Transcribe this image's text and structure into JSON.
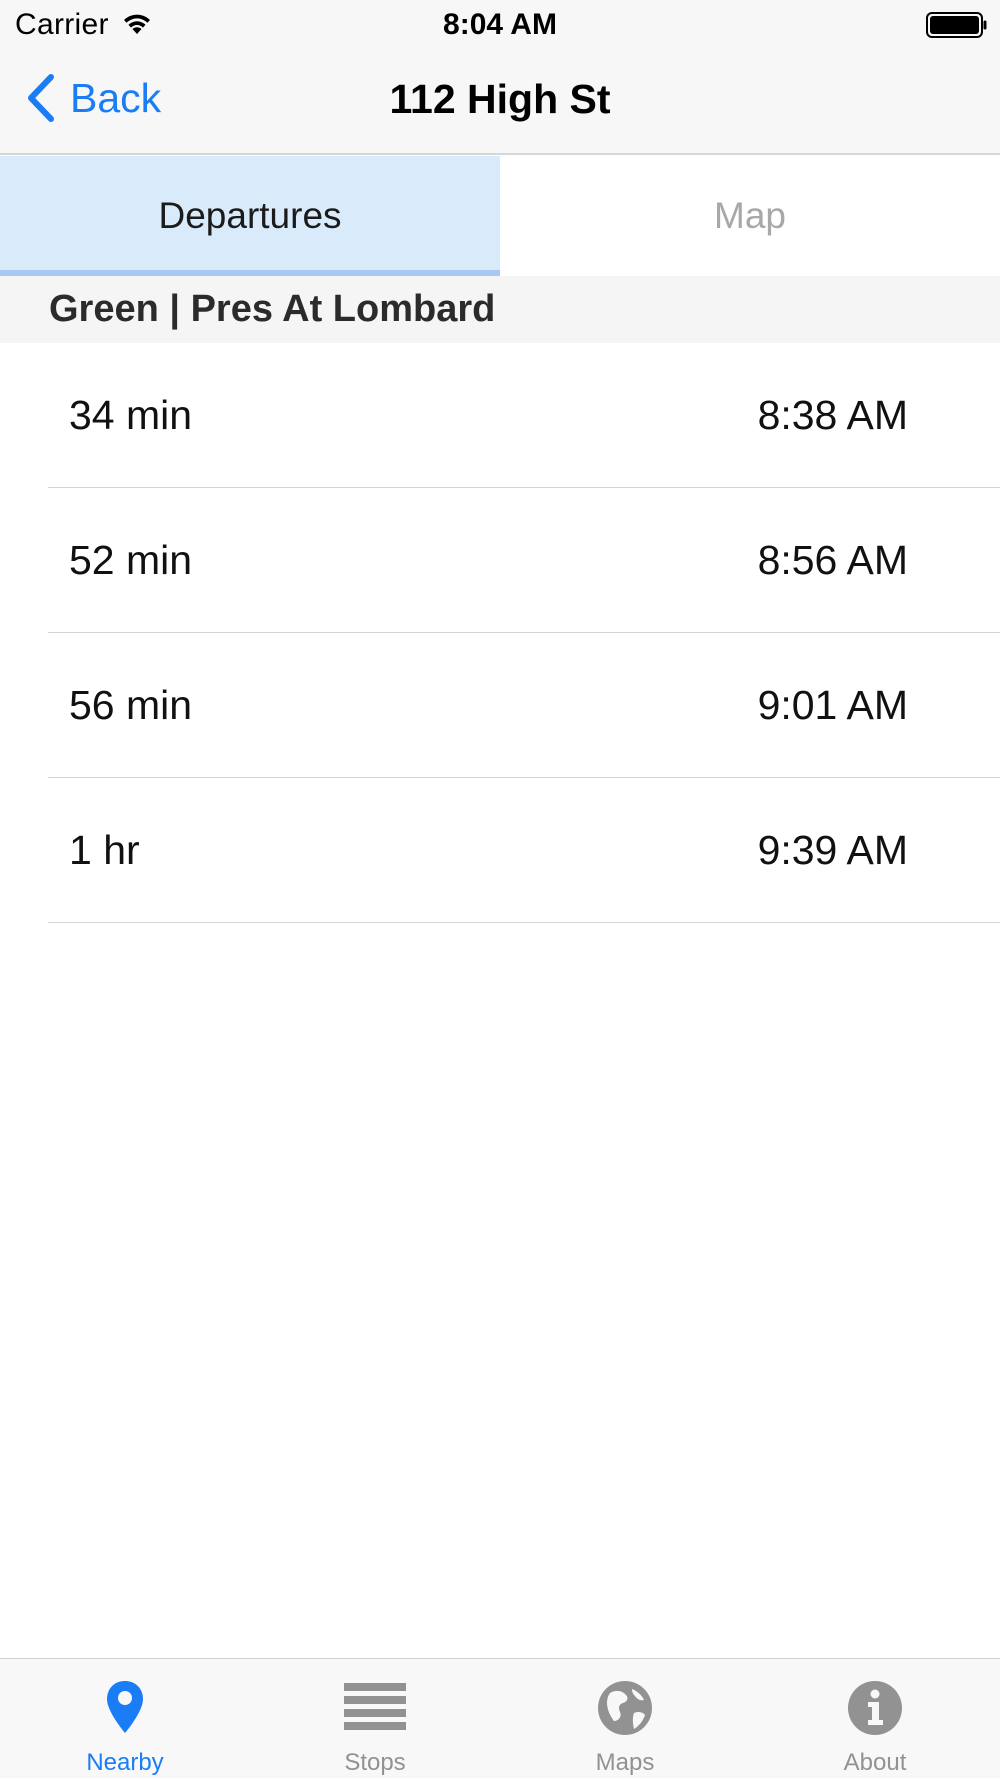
{
  "status_bar": {
    "carrier": "Carrier",
    "time": "8:04 AM",
    "wifi_icon": "wifi-icon",
    "battery_icon": "battery-icon"
  },
  "nav": {
    "back_label": "Back",
    "title": "112 High St"
  },
  "segments": [
    {
      "label": "Departures",
      "selected": true
    },
    {
      "label": "Map",
      "selected": false
    }
  ],
  "section": {
    "header": "Green | Pres At Lombard"
  },
  "departures": [
    {
      "wait": "34 min",
      "time": "8:38 AM"
    },
    {
      "wait": "52 min",
      "time": "8:56 AM"
    },
    {
      "wait": "56 min",
      "time": "9:01 AM"
    },
    {
      "wait": "1 hr",
      "time": "9:39 AM"
    }
  ],
  "tab_bar": {
    "items": [
      {
        "label": "Nearby",
        "icon": "location-pin-icon",
        "selected": true
      },
      {
        "label": "Stops",
        "icon": "list-icon",
        "selected": false
      },
      {
        "label": "Maps",
        "icon": "globe-icon",
        "selected": false
      },
      {
        "label": "About",
        "icon": "info-icon",
        "selected": false
      }
    ]
  },
  "colors": {
    "accent": "#1a7df5",
    "selected_segment_bg": "#d9ebfb",
    "selected_segment_underline": "#a8c7f3",
    "inactive_tab": "#929292"
  }
}
